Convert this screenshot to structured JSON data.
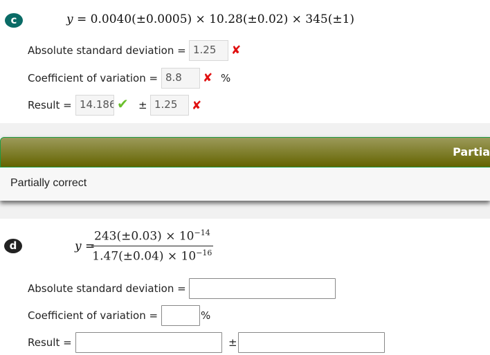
{
  "part_c": {
    "badge": "c",
    "equation": {
      "lhs": "y",
      "equals": "=",
      "rhs": "0.0040(±0.0005) × 10.28(±0.02) × 345(±1)"
    },
    "abs_sd": {
      "label": "Absolute standard deviation =",
      "value": "1.25",
      "status": "incorrect",
      "status_icon": "✘"
    },
    "cv": {
      "label": "Coefficient of variation =",
      "value": "8.8",
      "status": "incorrect",
      "status_icon": "✘",
      "unit": "%"
    },
    "result": {
      "label": "Result =",
      "value": "14.186",
      "value_status": "correct",
      "value_status_icon": "✔",
      "pm": "±",
      "uncertainty": "1.25",
      "uncertainty_status": "incorrect",
      "uncertainty_status_icon": "✘"
    }
  },
  "feedback": {
    "header_title": "Partia",
    "body_text": "Partially correct",
    "colors": {
      "header_top": "#9c9a5a",
      "header_bottom": "#646400",
      "header_border": "#1d9a45"
    }
  },
  "part_d": {
    "badge": "d",
    "equation": {
      "lhs": "y",
      "equals": "=",
      "numerator": "243(±0.03) × 10",
      "numerator_exp": "−14",
      "denominator": "1.47(±0.04) × 10",
      "denominator_exp": "−16"
    },
    "abs_sd": {
      "label": "Absolute standard deviation =",
      "value": ""
    },
    "cv": {
      "label": "Coefficient of variation =",
      "value": "",
      "unit": "%"
    },
    "result": {
      "label": "Result =",
      "value": "",
      "pm": "±",
      "uncertainty": ""
    }
  }
}
